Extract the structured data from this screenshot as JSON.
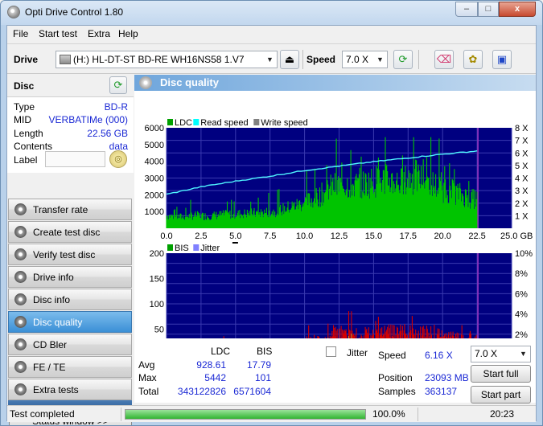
{
  "window": {
    "title": "Opti Drive Control 1.80",
    "buttons": {
      "minimize": "–",
      "maximize": "□",
      "close": "x"
    }
  },
  "menu": [
    "File",
    "Start test",
    "Extra",
    "Help"
  ],
  "toolbar": {
    "drive_label": "Drive",
    "drive_value": "(H:)   HL-DT-ST BD-RE  WH16NS58 1.V7",
    "speed_label": "Speed",
    "speed_value": "7.0 X",
    "icons": [
      "disc-drive-icon",
      "eject-icon",
      "refresh-icon",
      "eraser-icon",
      "yellow-tool-icon",
      "save-icon"
    ]
  },
  "disc": {
    "header": "Disc",
    "type_label": "Type",
    "type_value": "BD-R",
    "mid_label": "MID",
    "mid_value": "VERBATIMe (000)",
    "length_label": "Length",
    "length_value": "22.56 GB",
    "contents_label": "Contents",
    "contents_value": "data",
    "label_label": "Label",
    "label_value": ""
  },
  "nav": [
    {
      "label": "Transfer rate",
      "active": false
    },
    {
      "label": "Create test disc",
      "active": false
    },
    {
      "label": "Verify test disc",
      "active": false
    },
    {
      "label": "Drive info",
      "active": false
    },
    {
      "label": "Disc info",
      "active": false
    },
    {
      "label": "Disc quality",
      "active": true
    },
    {
      "label": "CD Bler",
      "active": false
    },
    {
      "label": "FE / TE",
      "active": false
    },
    {
      "label": "Extra tests",
      "active": false
    }
  ],
  "status_window_button": "Status window >>",
  "panel_title": "Disc quality",
  "chart_data": [
    {
      "type": "area",
      "legend": [
        "LDC",
        "Read speed",
        "Write speed"
      ],
      "legend_colors": [
        "#00a000",
        "#00ffff",
        "#808080"
      ],
      "x_ticks": [
        "0.0",
        "2.5",
        "5.0",
        "7.5",
        "10.0",
        "12.5",
        "15.0",
        "17.5",
        "20.0",
        "22.5",
        "25.0 GB"
      ],
      "xlim": [
        0,
        25
      ],
      "x_unit": "GB",
      "y_ticks": [
        "1000",
        "2000",
        "3000",
        "4000",
        "5000",
        "6000"
      ],
      "ylim": [
        0,
        6000
      ],
      "y2_ticks": [
        "1 X",
        "2 X",
        "3 X",
        "4 X",
        "5 X",
        "6 X",
        "7 X",
        "8 X"
      ],
      "y2lim": [
        0,
        8
      ],
      "grid": true,
      "series": [
        {
          "name": "LDC",
          "color": "#00c400",
          "x": [
            0,
            1,
            2,
            3,
            4,
            5,
            6,
            7,
            8,
            9,
            10,
            11,
            12,
            13,
            14,
            15,
            16,
            17,
            18,
            19,
            20,
            21,
            22,
            22.56
          ],
          "y": [
            900,
            800,
            900,
            850,
            950,
            1000,
            1050,
            1100,
            1200,
            1500,
            1800,
            2200,
            2900,
            3100,
            3000,
            3300,
            3400,
            3200,
            3600,
            3300,
            2700,
            2500,
            2100,
            2000
          ]
        },
        {
          "name": "Read speed",
          "color": "#4ff5ff",
          "x": [
            0,
            2.5,
            5,
            7.5,
            10,
            12.5,
            15,
            17.5,
            20,
            22.56
          ],
          "y": [
            2.7,
            3.3,
            3.75,
            4.15,
            4.6,
            4.95,
            5.3,
            5.6,
            5.9,
            6.16
          ]
        }
      ]
    },
    {
      "type": "area",
      "legend": [
        "BIS",
        "Jitter"
      ],
      "legend_colors": [
        "#00a000",
        "#8080ff"
      ],
      "x_ticks": [
        "0.0",
        "2.5",
        "5.0",
        "7.5",
        "10.0",
        "12.5",
        "15.0",
        "17.5",
        "20.0",
        "22.5",
        "25.0 GB"
      ],
      "xlim": [
        0,
        25
      ],
      "x_unit": "GB",
      "y_ticks": [
        "50",
        "100",
        "150",
        "200"
      ],
      "ylim": [
        0,
        200
      ],
      "y2_ticks": [
        "2%",
        "4%",
        "6%",
        "8%",
        "10%"
      ],
      "y2lim": [
        0,
        10
      ],
      "grid": true,
      "series": [
        {
          "name": "BIS",
          "color": "#d40000",
          "x": [
            0,
            1,
            2,
            3,
            4,
            5,
            6,
            7,
            8,
            9,
            10,
            11,
            12,
            13,
            14,
            15,
            16,
            17,
            18,
            19,
            20,
            21,
            22,
            22.56
          ],
          "y": [
            15,
            15,
            16,
            17,
            16,
            17,
            18,
            18,
            17,
            18,
            25,
            30,
            42,
            40,
            38,
            40,
            42,
            45,
            40,
            42,
            36,
            33,
            30,
            28
          ]
        }
      ]
    }
  ],
  "stats": {
    "col_ldc": "LDC",
    "col_bis": "BIS",
    "avg_label": "Avg",
    "avg_ldc": "928.61",
    "avg_bis": "17.79",
    "max_label": "Max",
    "max_ldc": "5442",
    "max_bis": "101",
    "total_label": "Total",
    "total_ldc": "343122826",
    "total_bis": "6571604",
    "jitter_label": "Jitter",
    "jitter_checked": false,
    "speed_label": "Speed",
    "speed_value": "6.16 X",
    "position_label": "Position",
    "position_value": "23093 MB",
    "samples_label": "Samples",
    "samples_value": "363137",
    "speed_select": "7.0 X",
    "start_full": "Start full",
    "start_part": "Start part"
  },
  "statusbar": {
    "text": "Test completed",
    "progress": 1.0,
    "progress_text": "100.0%",
    "time": "20:23"
  }
}
